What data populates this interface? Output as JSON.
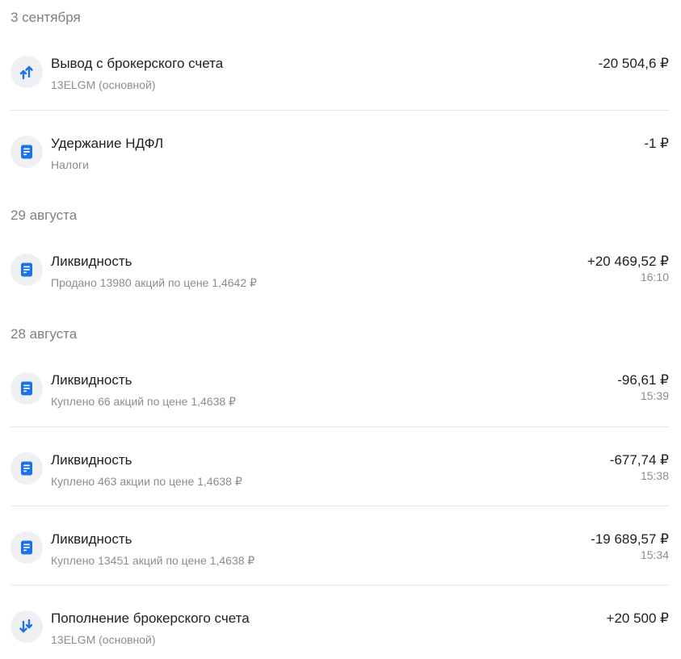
{
  "groups": [
    {
      "date": "3 сентября",
      "operations": [
        {
          "icon": "withdraw-arrows-icon",
          "title": "Вывод с брокерского счета",
          "subtitle": "13ELGM (основной)",
          "amount": "-20 504,6 ₽",
          "time": ""
        },
        {
          "icon": "document-icon",
          "title": "Удержание НДФЛ",
          "subtitle": "Налоги",
          "amount": "-1 ₽",
          "time": ""
        }
      ]
    },
    {
      "date": "29 августа",
      "operations": [
        {
          "icon": "document-icon",
          "title": "Ликвидность",
          "subtitle": "Продано 13980 акций по цене 1,4642 ₽",
          "amount": "+20 469,52 ₽",
          "time": "16:10"
        }
      ]
    },
    {
      "date": "28 августа",
      "operations": [
        {
          "icon": "document-icon",
          "title": "Ликвидность",
          "subtitle": "Куплено 66 акций по цене 1,4638 ₽",
          "amount": "-96,61 ₽",
          "time": "15:39"
        },
        {
          "icon": "document-icon",
          "title": "Ликвидность",
          "subtitle": "Куплено 463 акции по цене 1,4638 ₽",
          "amount": "-677,74 ₽",
          "time": "15:38"
        },
        {
          "icon": "document-icon",
          "title": "Ликвидность",
          "subtitle": "Куплено 13451 акций по цене 1,4638 ₽",
          "amount": "-19 689,57 ₽",
          "time": "15:34"
        },
        {
          "icon": "deposit-arrows-icon",
          "title": "Пополнение брокерского счета",
          "subtitle": "13ELGM (основной)",
          "amount": "+20 500 ₽",
          "time": ""
        }
      ]
    }
  ],
  "colors": {
    "accent": "#1a73e8",
    "icon_bg": "#eef0f3",
    "muted_text": "#8c8c8c"
  }
}
